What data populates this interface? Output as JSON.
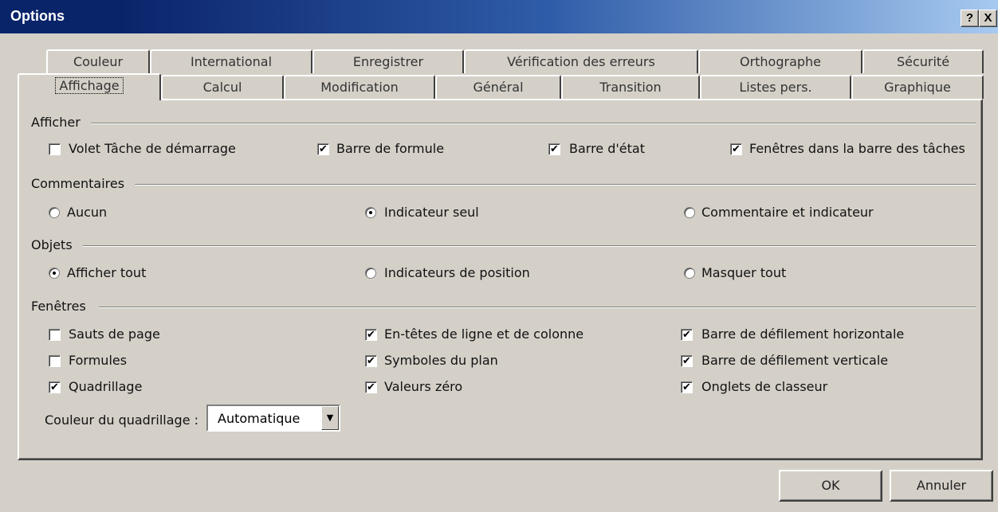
{
  "window": {
    "title": "Options",
    "help_btn": "?",
    "close_btn": "X"
  },
  "tabs_back": [
    "Couleur",
    "International",
    "Enregistrer",
    "Vérification des erreurs",
    "Orthographe",
    "Sécurité"
  ],
  "tabs_front": [
    "Affichage",
    "Calcul",
    "Modification",
    "Général",
    "Transition",
    "Listes pers.",
    "Graphique"
  ],
  "sections": {
    "afficher": "Afficher",
    "commentaires": "Commentaires",
    "objets": "Objets",
    "fenetres": "Fenêtres"
  },
  "afficher": [
    {
      "label": "Volet Tâche de démarrage",
      "checked": false
    },
    {
      "label": "Barre de formule",
      "checked": true
    },
    {
      "label": "Barre d'état",
      "checked": true
    },
    {
      "label": "Fenêtres dans la barre des tâches",
      "checked": true
    }
  ],
  "commentaires": [
    {
      "label": "Aucun",
      "selected": false
    },
    {
      "label": "Indicateur seul",
      "selected": true
    },
    {
      "label": "Commentaire et indicateur",
      "selected": false
    }
  ],
  "objets": [
    {
      "label": "Afficher tout",
      "selected": true
    },
    {
      "label": "Indicateurs de position",
      "selected": false
    },
    {
      "label": "Masquer tout",
      "selected": false
    }
  ],
  "fenetres": [
    {
      "label": "Sauts de page",
      "checked": false
    },
    {
      "label": "Formules",
      "checked": false
    },
    {
      "label": "Quadrillage",
      "checked": true
    },
    {
      "label": "En-têtes de ligne et de colonne",
      "checked": true
    },
    {
      "label": "Symboles du plan",
      "checked": true
    },
    {
      "label": "Valeurs zéro",
      "checked": true
    },
    {
      "label": "Barre de défilement horizontale",
      "checked": true
    },
    {
      "label": "Barre de défilement verticale",
      "checked": true
    },
    {
      "label": "Onglets de classeur",
      "checked": true
    }
  ],
  "gridline_color": {
    "label": "Couleur du quadrillage :",
    "value": "Automatique"
  },
  "buttons": {
    "ok": "OK",
    "cancel": "Annuler"
  },
  "check_mark": "✔",
  "dropdown_arrow": "▼"
}
